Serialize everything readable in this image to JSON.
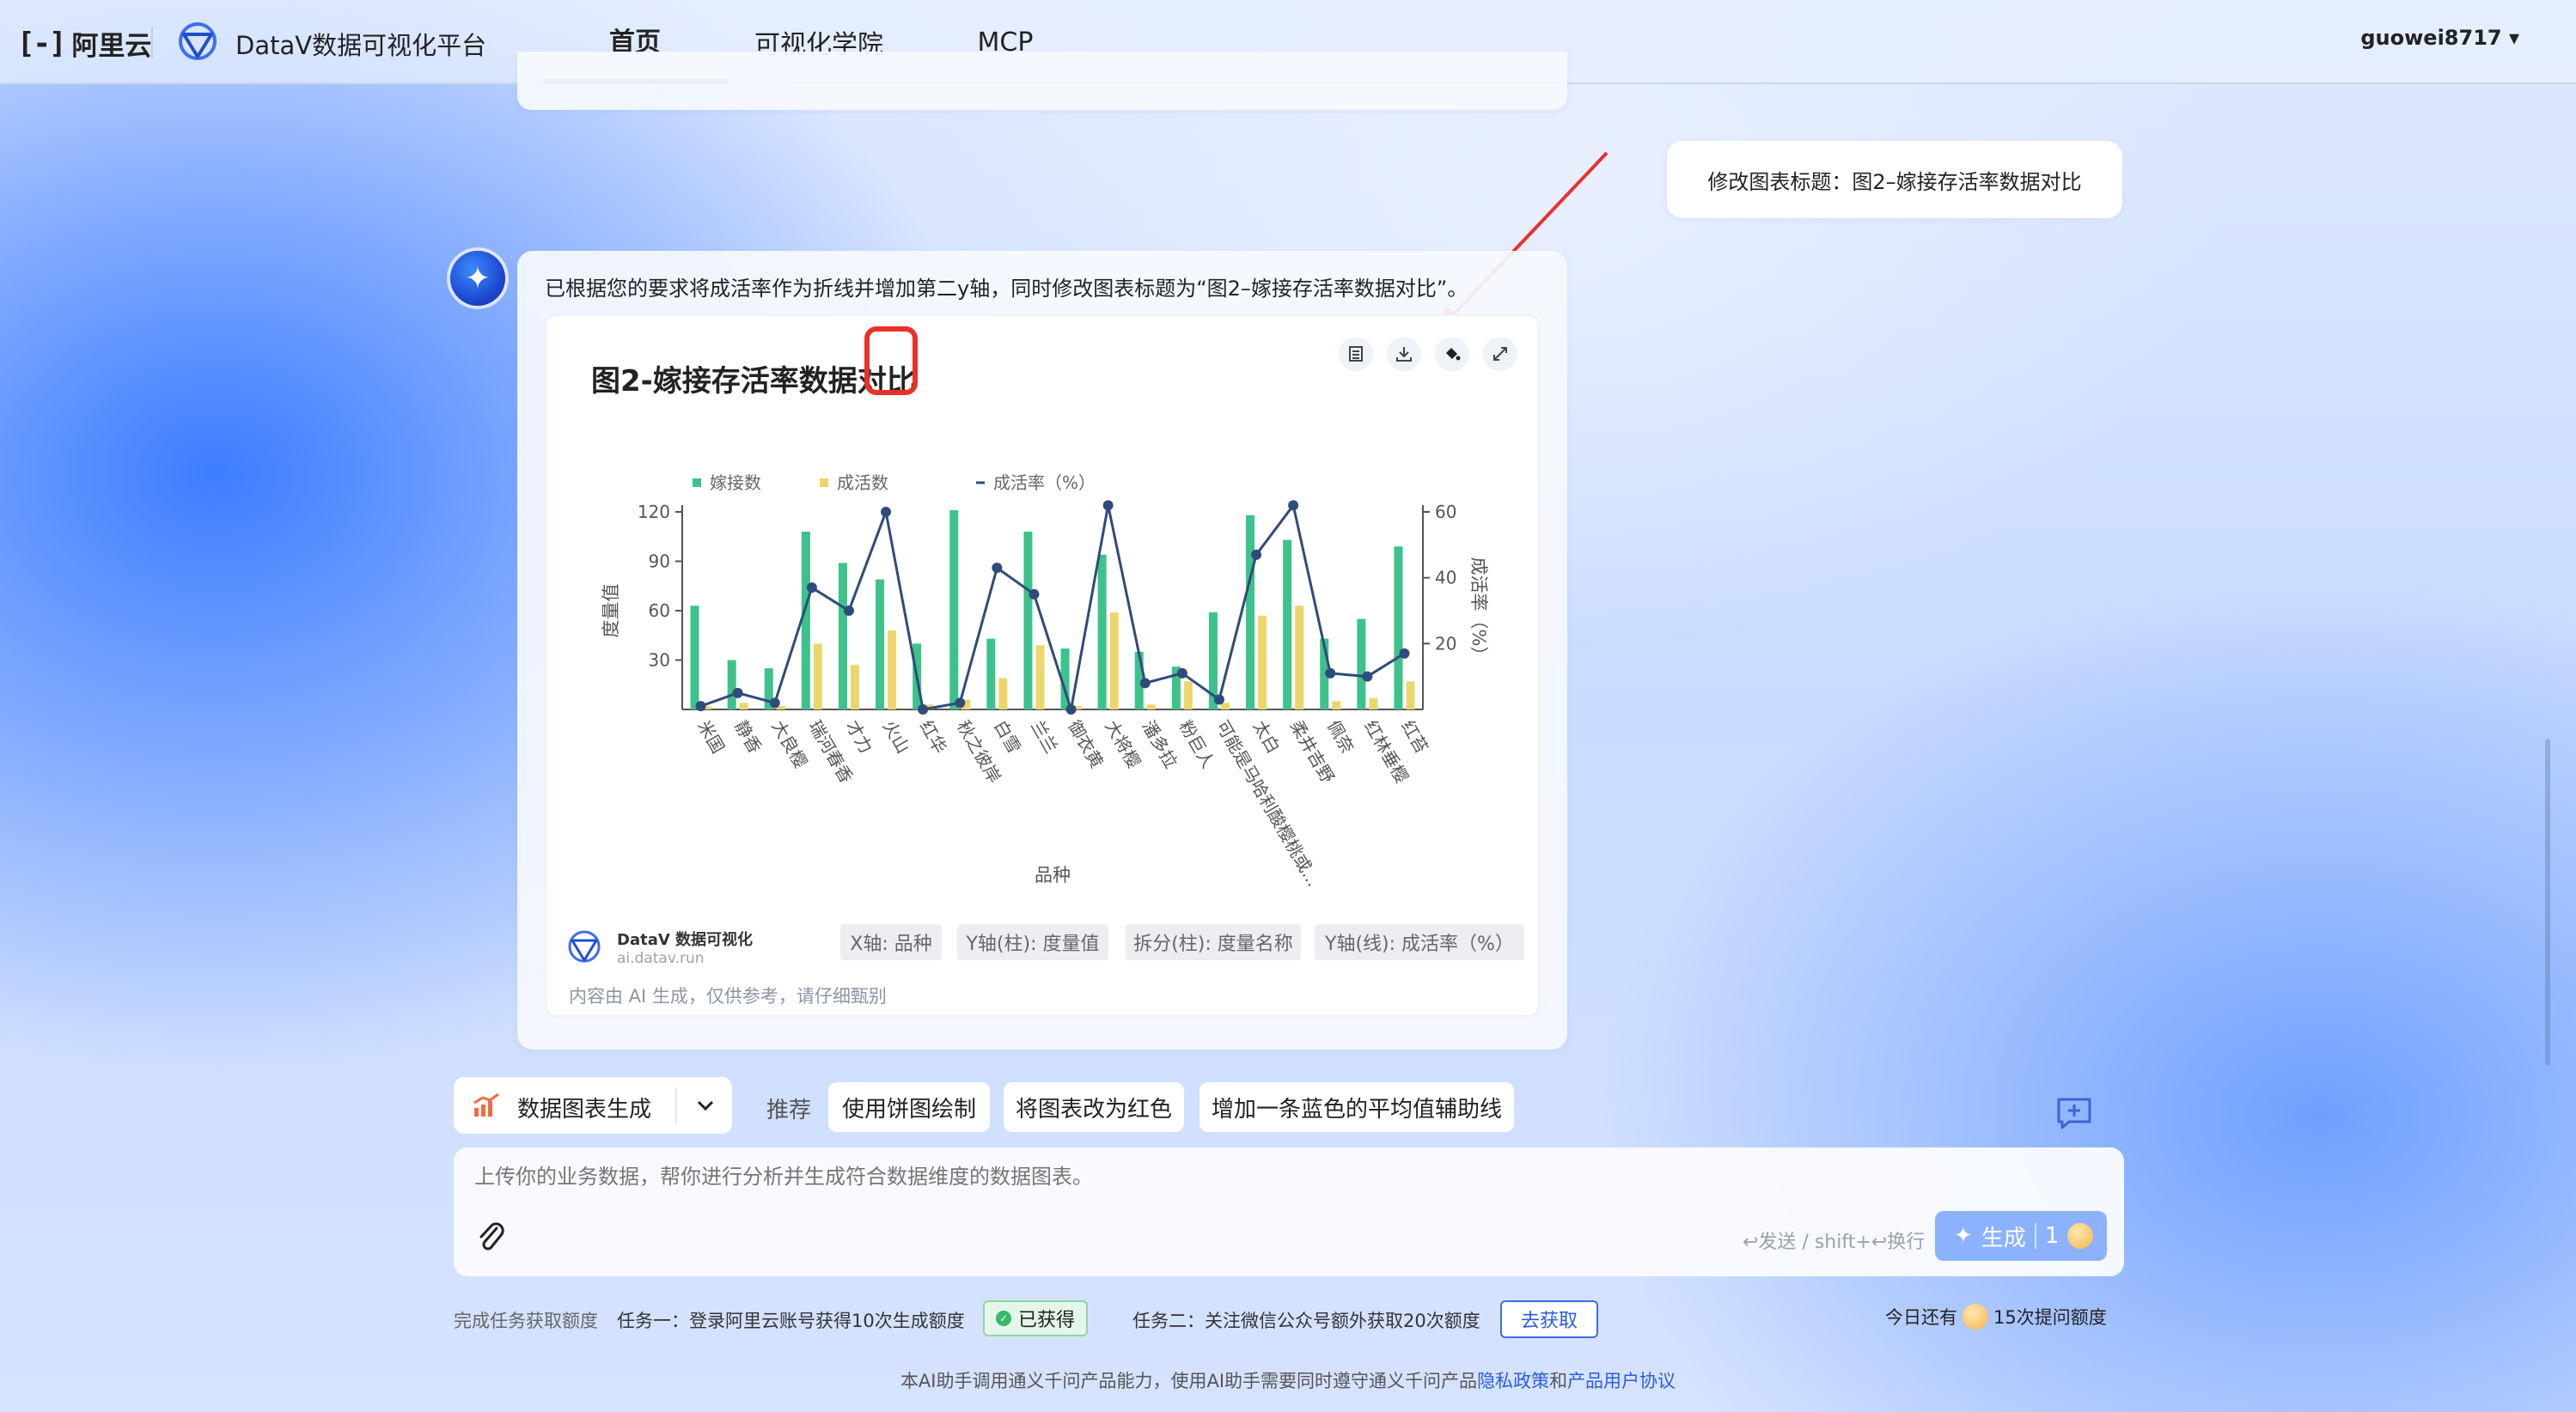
{
  "header": {
    "aliyun_mark": "[-]",
    "aliyun_text": "阿里云",
    "platform": "DataV数据可视化平台",
    "tabs": [
      {
        "label": "首页",
        "active": true
      },
      {
        "label": "可视化学院",
        "active": false
      },
      {
        "label": "MCP",
        "active": false
      }
    ],
    "user": "guowei8717 ▾"
  },
  "user_message": "修改图表标题：图2–嫁接存活率数据对比",
  "bot_message": "已根据您的要求将成活率作为折线并增加第二y轴，同时修改图表标题为“图2–嫁接存活率数据对比”。",
  "chart_card": {
    "toolbar": [
      "table-icon",
      "download-icon",
      "paint-bucket-icon",
      "expand-icon"
    ],
    "brand": "DataV 数据可视化",
    "url": "ai.datav.run",
    "tags": [
      "X轴: 品种",
      "Y轴(柱): 度量值",
      "拆分(柱): 度量名称",
      "Y轴(线): 成活率（%）"
    ],
    "disclaimer": "内容由 AI 生成，仅供参考，请仔细甄别"
  },
  "chart_data": {
    "type": "bar",
    "title": "图2-嫁接存活率数据对比",
    "xlabel": "品种",
    "ylabel": "度量值",
    "y2label": "成活率（%）",
    "ylim": [
      0,
      120
    ],
    "yticks": [
      30,
      60,
      90,
      120
    ],
    "y2lim": [
      0,
      60
    ],
    "y2ticks": [
      20,
      40,
      60
    ],
    "legend": [
      "嫁接数",
      "成活数",
      "成活率（%）"
    ],
    "legend_position": "top-left",
    "categories": [
      "米国",
      "静香",
      "大良樱",
      "瑞河春香",
      "才力",
      "火山",
      "红华",
      "秋之彼岸",
      "白雪",
      "兰兰",
      "御衣黄",
      "大将樱",
      "潘多拉",
      "粉巨人",
      "可能是马哈利酸樱桃或...",
      "太白",
      "柔井吉野",
      "佩奈",
      "红林垂樱",
      "红苔"
    ],
    "series": [
      {
        "name": "嫁接数",
        "type": "bar",
        "color": "#3cc28a",
        "values": [
          63,
          30,
          25,
          108,
          89,
          79,
          40,
          121,
          43,
          108,
          37,
          94,
          35,
          26,
          59,
          118,
          103,
          43,
          55,
          99
        ]
      },
      {
        "name": "成活数",
        "type": "bar",
        "color": "#ecd66b",
        "values": [
          2,
          4,
          2,
          40,
          27,
          48,
          3,
          6,
          19,
          39,
          2,
          59,
          3,
          17,
          4,
          57,
          63,
          5,
          7,
          17
        ]
      },
      {
        "name": "成活率（%）",
        "type": "line",
        "axis": "y2",
        "color": "#2f4b7c",
        "values": [
          1,
          5,
          2,
          37,
          30,
          60,
          0,
          2,
          43,
          35,
          0,
          62,
          8,
          11,
          3,
          47,
          62,
          11,
          10,
          17
        ]
      }
    ]
  },
  "mode_select": {
    "label": "数据图表生成"
  },
  "suggestions": {
    "label": "推荐",
    "chips": [
      "使用饼图绘制",
      "将图表改为红色",
      "增加一条蓝色的平均值辅助线"
    ]
  },
  "input": {
    "placeholder": "上传你的业务数据，帮你进行分析并生成符合数据维度的数据图表。",
    "hint": "↩发送 / shift+↩换行",
    "generate": "生成",
    "generate_count": "1"
  },
  "tasks": {
    "label": "完成任务获取额度",
    "task1": "任务一：登录阿里云账号获得10次生成额度",
    "task1_status": "已获得",
    "task2": "任务二：关注微信公众号额外获取20次额度",
    "task2_action": "去获取",
    "quota_prefix": "今日还有",
    "quota_suffix": "15次提问额度"
  },
  "legal": {
    "prefix": "本AI助手调用通义千问产品能力，使用AI助手需要同时遵守通义千问产品",
    "privacy": "隐私政策",
    "and": "和",
    "agreement": "产品用户协议"
  }
}
